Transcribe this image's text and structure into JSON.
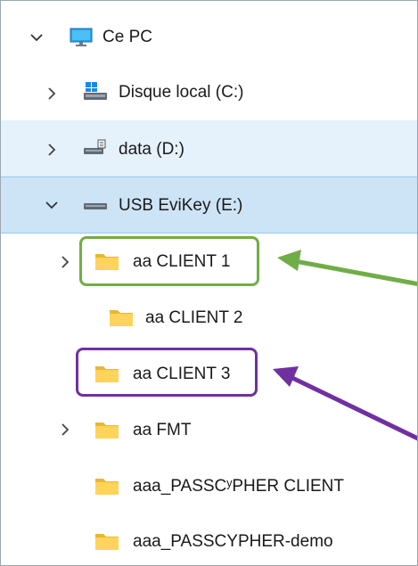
{
  "tree": {
    "root": {
      "label": "Ce PC",
      "icon": "monitor-icon",
      "expanded": true
    },
    "drives": [
      {
        "label": "Disque local (C:)",
        "icon": "local-disk-icon",
        "expanded": false,
        "state": "normal"
      },
      {
        "label": "data (D:)",
        "icon": "network-drive-icon",
        "expanded": false,
        "state": "hover"
      },
      {
        "label": "USB EviKey (E:)",
        "icon": "usb-drive-icon",
        "expanded": true,
        "state": "selected"
      }
    ],
    "folders": [
      {
        "label": "aa CLIENT 1",
        "icon": "folder-icon",
        "has_children": true,
        "highlight": "green"
      },
      {
        "label": "aa CLIENT 2",
        "icon": "folder-icon",
        "has_children": false,
        "highlight": ""
      },
      {
        "label": "aa CLIENT 3",
        "icon": "folder-icon",
        "has_children": false,
        "highlight": "purple"
      },
      {
        "label": "aa FMT",
        "icon": "folder-icon",
        "has_children": true,
        "highlight": ""
      },
      {
        "label": "aaa_PASSCʸPHER CLIENT",
        "icon": "folder-icon",
        "has_children": false,
        "highlight": ""
      },
      {
        "label": "aaa_PASSCYPHER-demo",
        "icon": "folder-icon",
        "has_children": false,
        "highlight": ""
      }
    ]
  },
  "annotations": {
    "green_color": "#70ad47",
    "purple_color": "#7030a0"
  }
}
